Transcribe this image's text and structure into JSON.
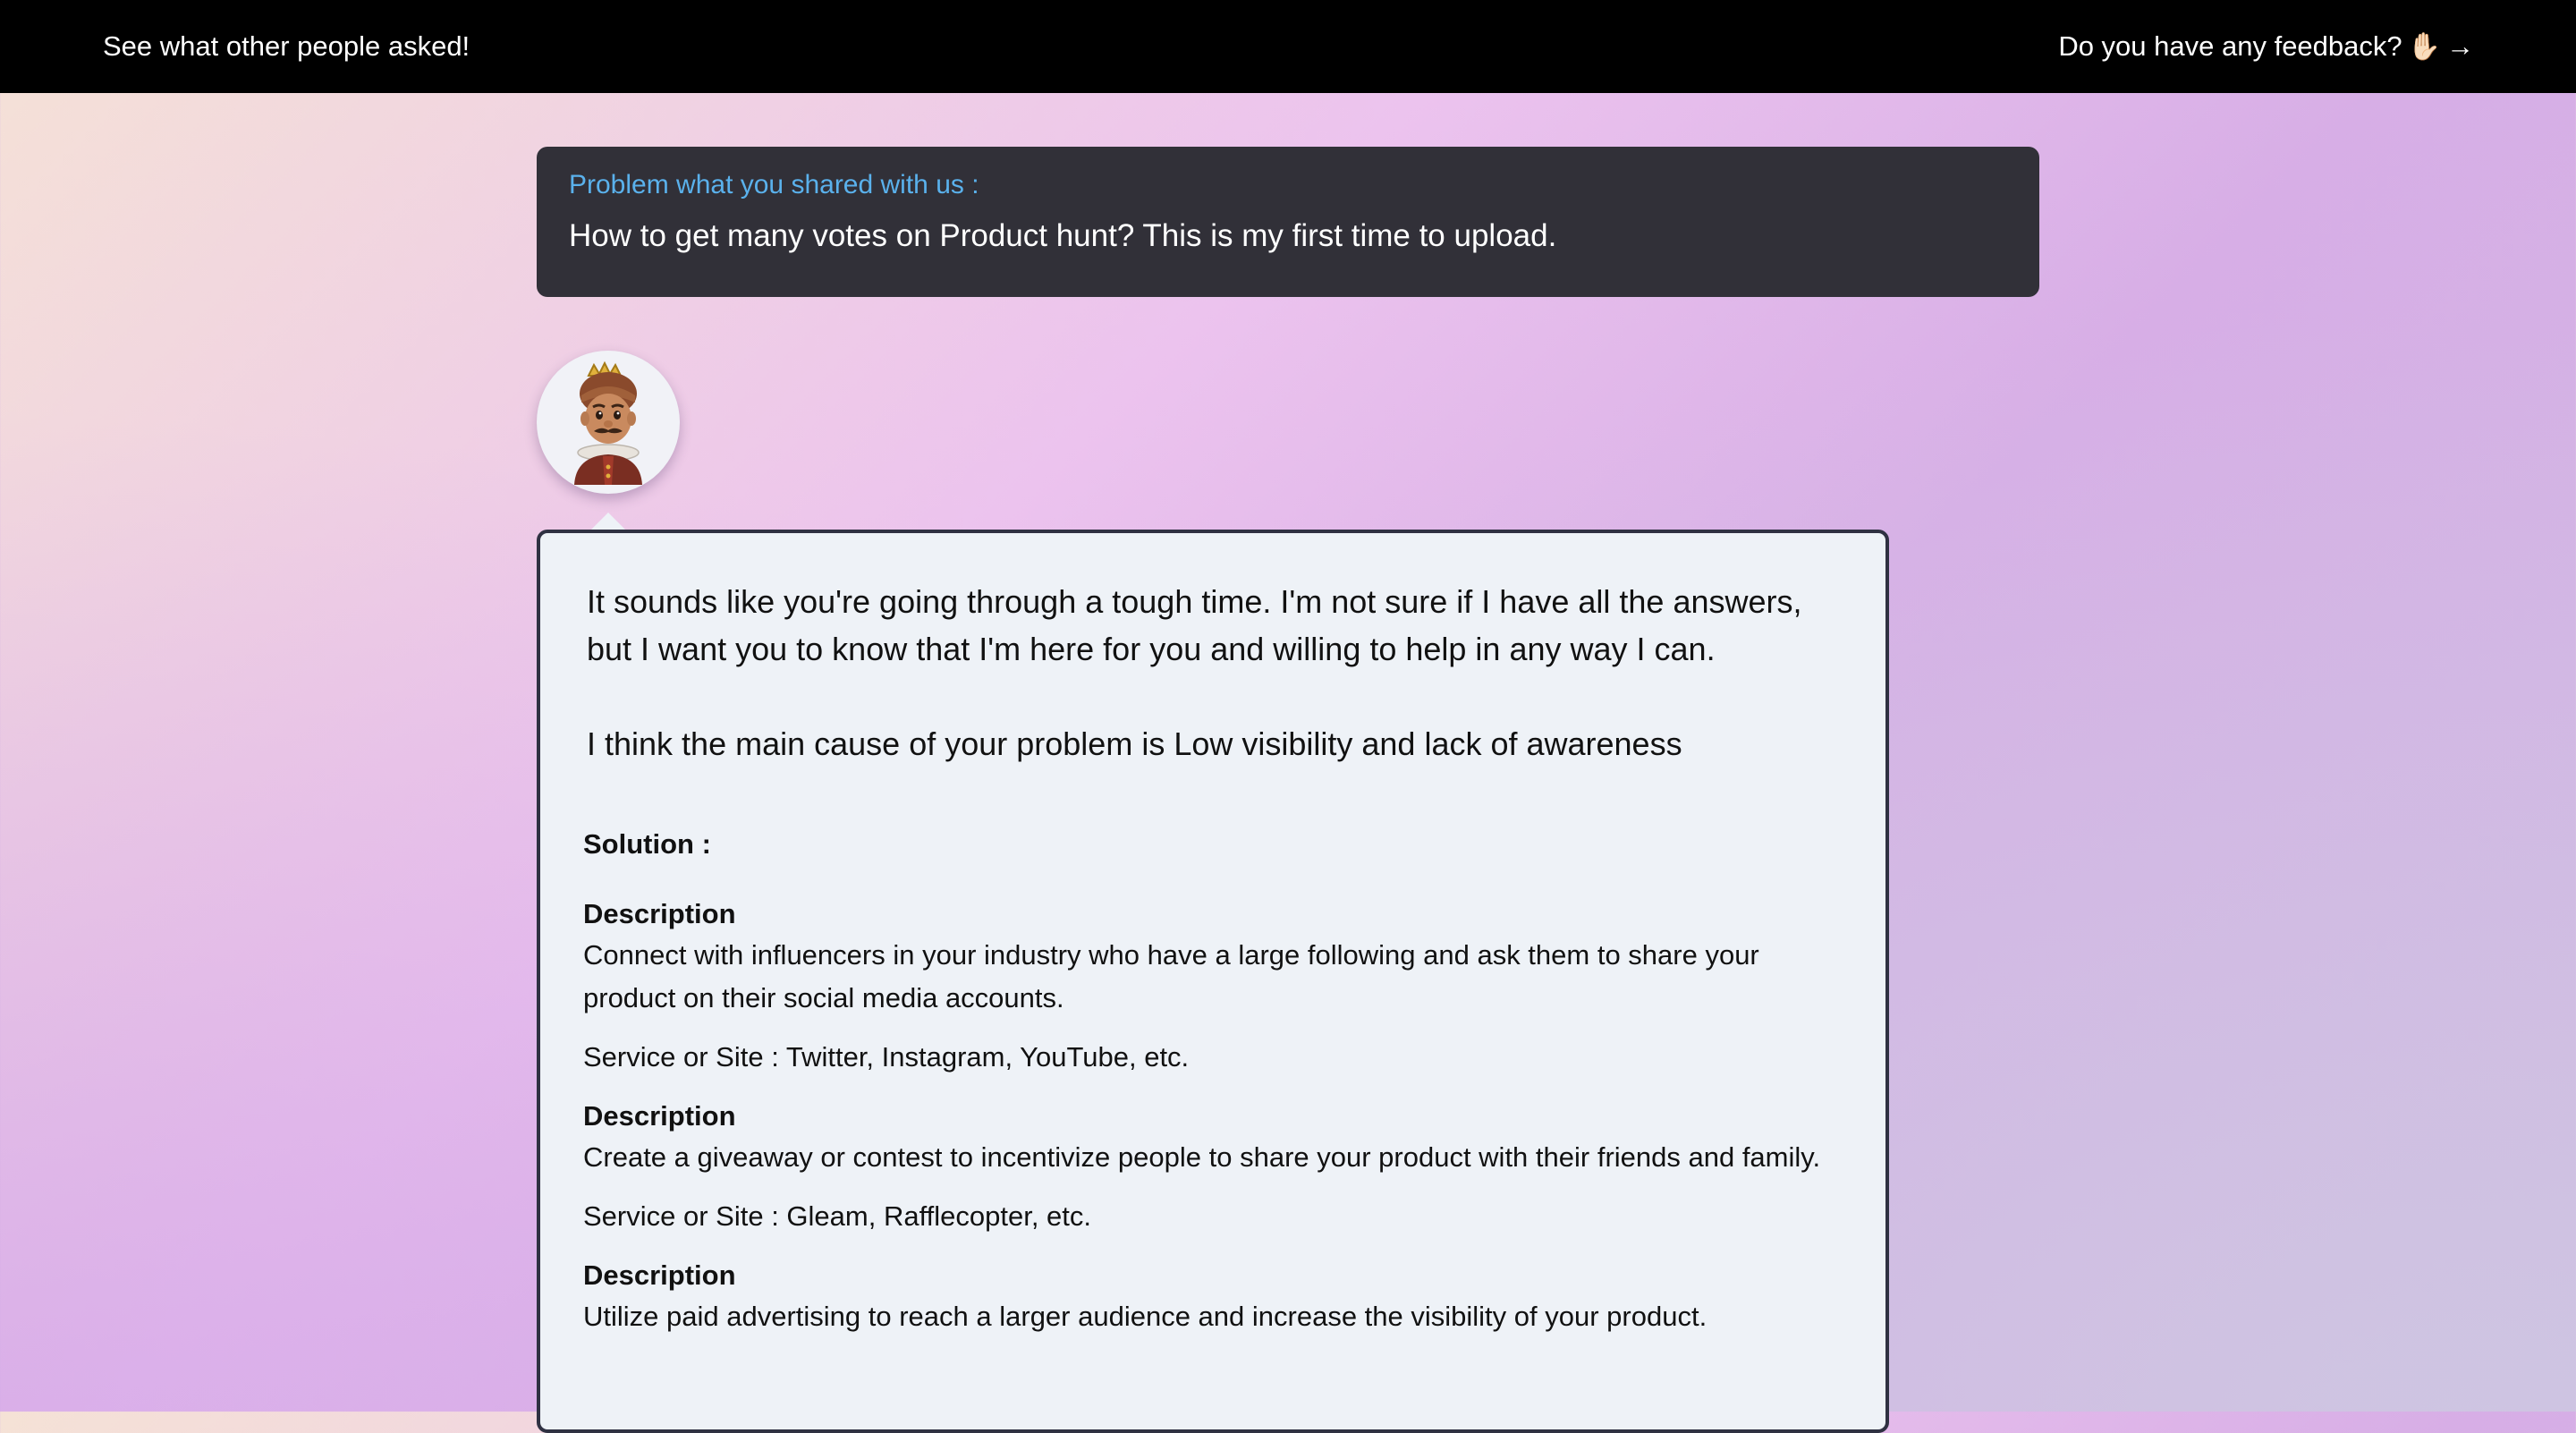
{
  "topbar": {
    "left_link": "See what other people asked!",
    "feedback_label": "Do you have any feedback?",
    "feedback_emoji": "✋🏻",
    "feedback_arrow": "→"
  },
  "problem": {
    "label": "Problem what you shared with us :",
    "text": "How to get many votes on Product hunt? This is my first time to upload."
  },
  "answer": {
    "intro": "It sounds like you're going through a tough time. I'm not sure if I have all the answers, but I want you to know that I'm here for you and willing to help in any way I can.",
    "cause": "I think the main cause of your problem is Low visibility and lack of awareness",
    "solution_heading": "Solution :",
    "solutions": [
      {
        "desc_label": "Description",
        "desc": "Connect with influencers in your industry who have a large following and ask them to share your product on their social media accounts.",
        "service": "Service or Site : Twitter, Instagram, YouTube, etc."
      },
      {
        "desc_label": "Description",
        "desc": "Create a giveaway or contest to incentivize people to share your product with their friends and family.",
        "service": "Service or Site : Gleam, Rafflecopter, etc."
      },
      {
        "desc_label": "Description",
        "desc": "Utilize paid advertising to reach a larger audience and increase the visibility of your product.",
        "service": ""
      }
    ]
  },
  "avatar": {
    "icon": "king-avatar-icon"
  },
  "colors": {
    "topbar_bg": "#000000",
    "problem_card_bg": "#313038",
    "problem_label": "#5ab1ec",
    "answer_card_bg": "#eef2f7",
    "answer_border": "#2f3142"
  }
}
